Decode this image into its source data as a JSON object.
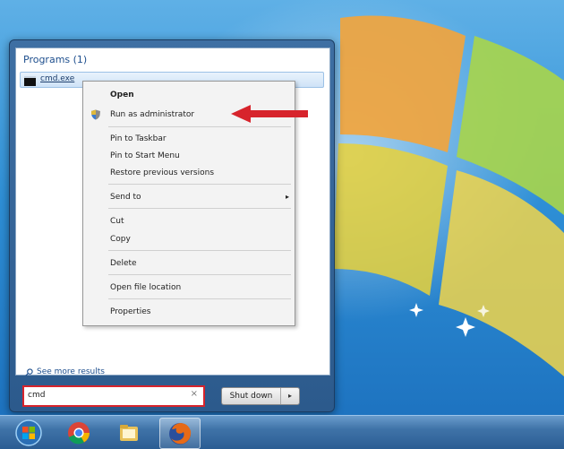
{
  "start_menu": {
    "programs_header": "Programs (1)",
    "program_item": {
      "label": "cmd.exe",
      "icon": "cmd-icon"
    },
    "see_more": "See more results",
    "search": {
      "value": "cmd",
      "clear_icon": "×"
    },
    "shutdown": {
      "label": "Shut down",
      "arrow": "▸"
    }
  },
  "context_menu": {
    "items": [
      {
        "label": "Open"
      },
      {
        "label": "Run as administrator",
        "icon": "shield-icon"
      },
      {
        "label": "Pin to Taskbar"
      },
      {
        "label": "Pin to Start Menu"
      },
      {
        "label": "Restore previous versions"
      },
      {
        "label": "Send to",
        "submenu_arrow": "▸"
      },
      {
        "label": "Cut"
      },
      {
        "label": "Copy"
      },
      {
        "label": "Delete"
      },
      {
        "label": "Open file location"
      },
      {
        "label": "Properties"
      }
    ]
  },
  "annotation": {
    "arrow_color": "#d7242c",
    "search_highlight_color": "#d7242c"
  },
  "taskbar": {
    "items": [
      {
        "icon": "windows-start-orb-icon"
      },
      {
        "icon": "chrome-icon"
      },
      {
        "icon": "file-explorer-icon"
      },
      {
        "icon": "firefox-icon"
      }
    ]
  }
}
